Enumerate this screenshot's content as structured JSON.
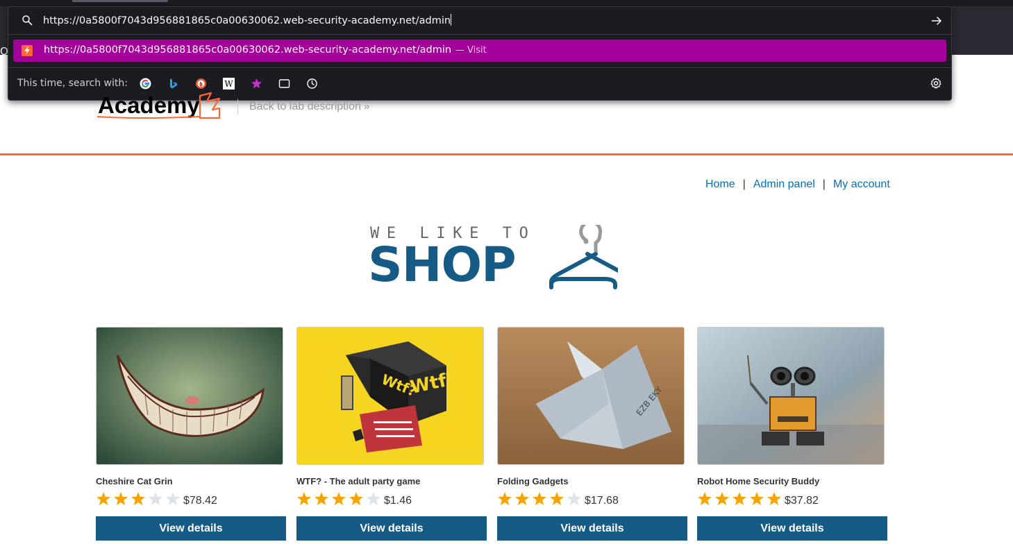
{
  "browser": {
    "partial_tab_text": "Oc",
    "urlbar": {
      "input_value": "https://0a5800f7043d956881865c0a00630062.web-security-academy.net/admin",
      "result": {
        "url": "https://0a5800f7043d956881865c0a00630062.web-security-academy.net/admin",
        "separator": "—",
        "action": "Visit"
      },
      "search_with_label": "This time, search with:",
      "engines": [
        "google-icon",
        "bing-icon",
        "duckduckgo-icon",
        "wikipedia-icon",
        "bookmarks-icon",
        "tabs-icon",
        "history-icon"
      ]
    }
  },
  "header": {
    "logo_text": "Academy",
    "back_link": "Back to lab description"
  },
  "nav": {
    "home": "Home",
    "admin": "Admin panel",
    "account": "My account",
    "separator": "|"
  },
  "shop_logo": {
    "tagline": "WE LIKE TO",
    "word": "SHOP"
  },
  "products": [
    {
      "name": "Cheshire Cat Grin",
      "rating": 3,
      "price": "$78.42",
      "button": "View details"
    },
    {
      "name": "WTF? - The adult party game",
      "rating": 4,
      "price": "$1.46",
      "button": "View details"
    },
    {
      "name": "Folding Gadgets",
      "rating": 4,
      "price": "$17.68",
      "button": "View details"
    },
    {
      "name": "Robot Home Security Buddy",
      "rating": 5,
      "price": "$37.82",
      "button": "View details"
    }
  ],
  "colors": {
    "accent_orange": "#ff6633",
    "brand_blue": "#165b85",
    "link_blue": "#0071bc",
    "urlbar_highlight": "#a4009a",
    "star_filled": "#f7a400",
    "star_empty": "#dde3e8"
  }
}
